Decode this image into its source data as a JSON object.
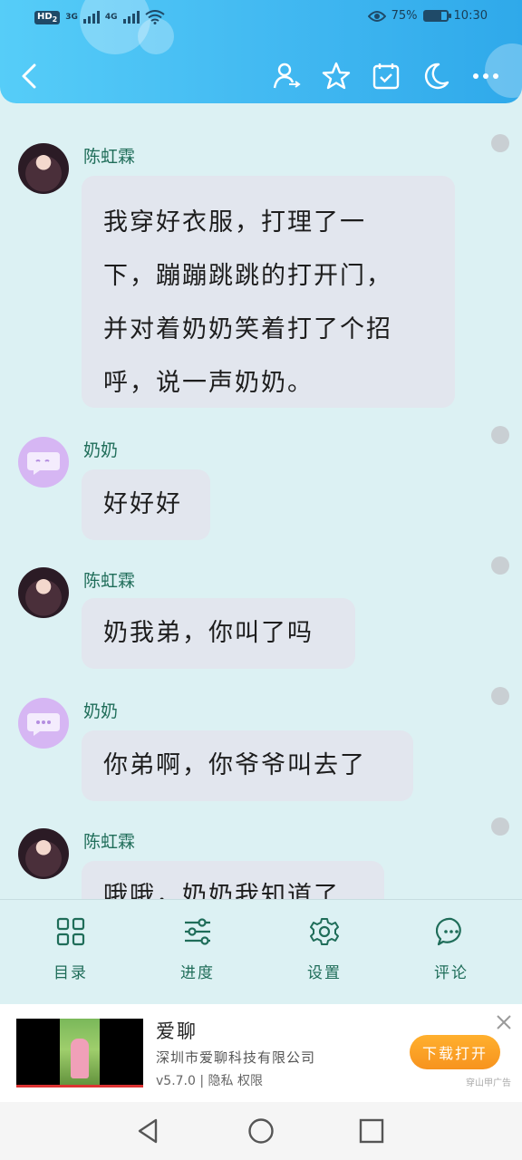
{
  "status_bar": {
    "hd_label": "HD",
    "hd_sub": "2",
    "net1": "3G",
    "net2": "4G",
    "battery_percent": "75%",
    "battery_level": 0.75,
    "time": "10:30"
  },
  "header": {
    "icons": [
      "back-icon",
      "user-switch-icon",
      "star-icon",
      "calendar-check-icon",
      "moon-icon",
      "more-icon"
    ]
  },
  "messages": [
    {
      "sender": "陈虹霖",
      "avatar": "girl",
      "lines": [
        "我穿好衣服，打理了一",
        "下，蹦蹦跳跳的打开门，",
        "并对着奶奶笑着打了个招",
        "呼，说一声奶奶。"
      ]
    },
    {
      "sender": "奶奶",
      "avatar": "grandma",
      "lines": [
        "好好好"
      ]
    },
    {
      "sender": "陈虹霖",
      "avatar": "girl",
      "lines": [
        "奶我弟，你叫了吗"
      ]
    },
    {
      "sender": "奶奶",
      "avatar": "grandma",
      "lines": [
        "你弟啊，你爷爷叫去了"
      ]
    },
    {
      "sender": "陈虹霖",
      "avatar": "girl",
      "lines": [
        "哦哦，奶奶我知道了"
      ]
    }
  ],
  "tabs": [
    {
      "label": "目录",
      "icon": "grid-icon"
    },
    {
      "label": "进度",
      "icon": "sliders-icon"
    },
    {
      "label": "设置",
      "icon": "gear-icon"
    },
    {
      "label": "评论",
      "icon": "chat-bubble-icon"
    }
  ],
  "ad": {
    "title": "爱聊",
    "company": "深圳市爱聊科技有限公司",
    "meta": "v5.7.0 | 隐私 权限",
    "button": "下载打开",
    "source": "穿山甲广告"
  },
  "colors": {
    "header": "#41b8f1",
    "background": "#dcf1f3",
    "bubble": "#e2e6ee",
    "name": "#1f6d59",
    "ad_button": "#f7931e"
  }
}
